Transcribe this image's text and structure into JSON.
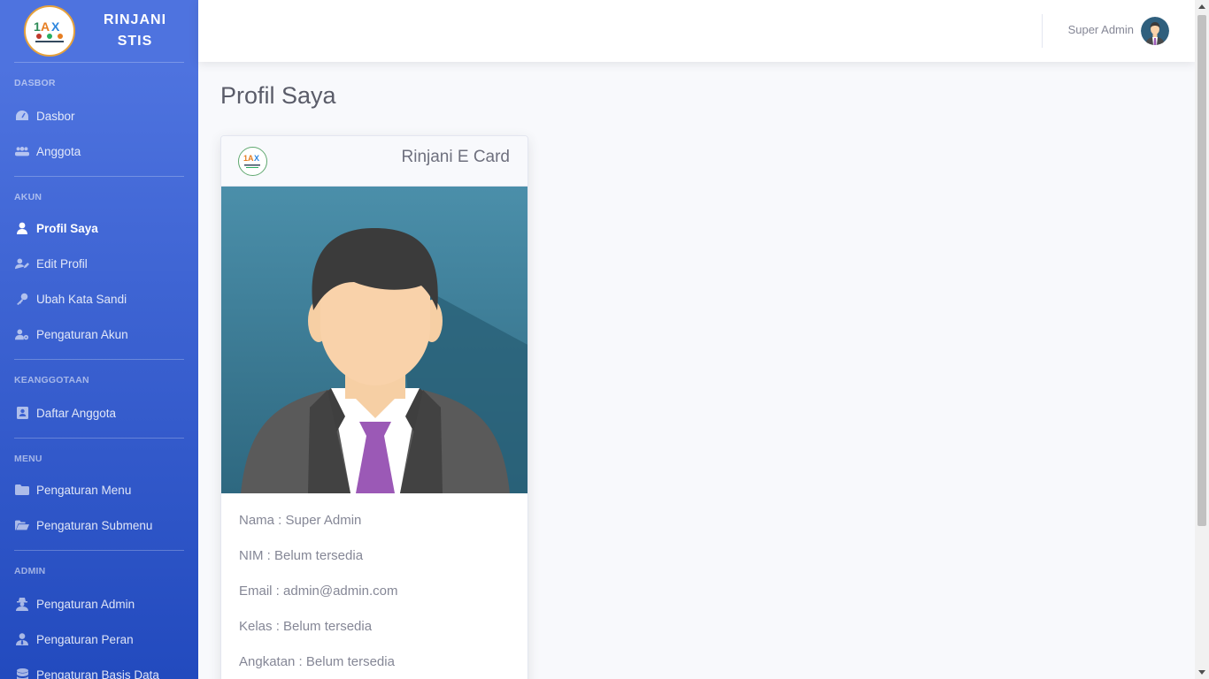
{
  "brand": {
    "line1": "RINJANI",
    "line2": "STIS"
  },
  "sidebar": {
    "sections": [
      {
        "heading": "DASBOR",
        "items": [
          {
            "label": "Dasbor",
            "icon": "tachometer-icon"
          },
          {
            "label": "Anggota",
            "icon": "users-icon"
          }
        ]
      },
      {
        "heading": "AKUN",
        "items": [
          {
            "label": "Profil Saya",
            "icon": "user-icon",
            "active": true
          },
          {
            "label": "Edit Profil",
            "icon": "user-edit-icon"
          },
          {
            "label": "Ubah Kata Sandi",
            "icon": "key-icon"
          },
          {
            "label": "Pengaturan Akun",
            "icon": "user-cog-icon"
          }
        ]
      },
      {
        "heading": "KEANGGOTAAN",
        "items": [
          {
            "label": "Daftar Anggota",
            "icon": "address-book-icon"
          }
        ]
      },
      {
        "heading": "MENU",
        "items": [
          {
            "label": "Pengaturan Menu",
            "icon": "folder-icon"
          },
          {
            "label": "Pengaturan Submenu",
            "icon": "folder-open-icon"
          }
        ]
      },
      {
        "heading": "ADMIN",
        "items": [
          {
            "label": "Pengaturan Admin",
            "icon": "user-secret-icon"
          },
          {
            "label": "Pengaturan Peran",
            "icon": "user-tie-icon"
          },
          {
            "label": "Pengaturan Basis Data",
            "icon": "database-icon"
          }
        ]
      }
    ]
  },
  "topbar": {
    "user_name": "Super Admin"
  },
  "page": {
    "title": "Profil Saya"
  },
  "card": {
    "title": "Rinjani E Card",
    "info": [
      "Nama : Super Admin",
      "NIM : Belum tersedia",
      "Email : admin@admin.com",
      "Kelas : Belum tersedia",
      "Angkatan : Belum tersedia"
    ]
  },
  "colors": {
    "sidebar_start": "#4e73df",
    "sidebar_end": "#224abe",
    "tie": "#9b59b6"
  }
}
